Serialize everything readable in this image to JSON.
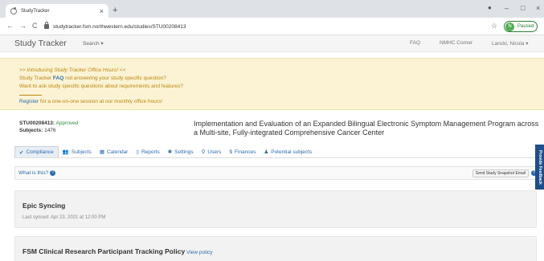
{
  "browser": {
    "tab_title": "StudyTracker",
    "tab_close": "×",
    "new_tab": "+",
    "url": "studytracker.fsm.northwestern.edu/studies/STU00208413",
    "profile_initial": "N",
    "profile_status": "Paused",
    "back": "←",
    "forward": "→",
    "reload": "C",
    "star": "☆",
    "minimize": "–",
    "maximize": "□",
    "close_window": "×"
  },
  "navbar": {
    "brand": "Study Tracker",
    "search": "Search ▾",
    "faq": "FAQ",
    "nmhc": "NMHC Corner",
    "user": "Lancki, Nicola ▾"
  },
  "announcement": {
    "intro": ">> Introducing Study Tracker Office Hours! <<",
    "line2_pre": "Study Tracker ",
    "line2_faq": "FAQ",
    "line2_post": " not answering your study specific question?",
    "line3": "Want to ask study specific questions about requirements and features?",
    "register_link": "Register",
    "register_rest": " for a one-on-one session at our monthly office hours!"
  },
  "study": {
    "id_label": "STU00208413:",
    "status": "Approved",
    "subjects_label": "Subjects:",
    "subjects_count": "1476",
    "title": "Implementation and Evaluation of an Expanded Bilingual Electronic Symptom Management Program across a Multi-site, Fully-integrated Comprehensive Cancer Center"
  },
  "tabs": [
    {
      "icon": "✔",
      "label": "Compliance"
    },
    {
      "icon": "👥",
      "label": "Subjects"
    },
    {
      "icon": "▦",
      "label": "Calendar"
    },
    {
      "icon": "▯",
      "label": "Reports"
    },
    {
      "icon": "✱",
      "label": "Settings"
    },
    {
      "icon": "⚲",
      "label": "Users"
    },
    {
      "icon": "$",
      "label": "Finances"
    },
    {
      "icon": "♟",
      "label": "Potential subjects"
    }
  ],
  "compliance": {
    "what_is_this": "What is this?",
    "snapshot_button": "Send Study Snapshot Email"
  },
  "epic": {
    "title": "Epic Syncing",
    "last_synced": "Last synced: Apr 23, 2021 at 12:00 PM"
  },
  "policy": {
    "title": "FSM Clinical Research Participant Tracking Policy",
    "link": "View policy"
  },
  "feedback": "Provide Feedback",
  "colors": {
    "link": "#2b6cb0",
    "announcement_bg": "#fcf3d4",
    "announcement_text": "#b8860b",
    "approved": "#2e8b3e",
    "feedback_bg": "#1f4f8a"
  }
}
